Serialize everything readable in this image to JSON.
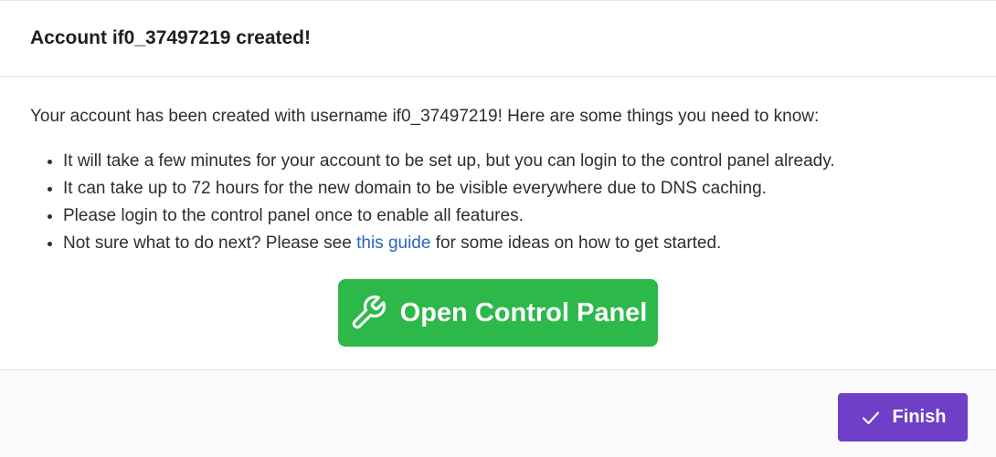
{
  "header": {
    "title": "Account if0_37497219 created!"
  },
  "body": {
    "intro": "Your account has been created with username if0_37497219! Here are some things you need to know:",
    "notes": [
      "It will take a few minutes for your account to be set up, but you can login to the control panel already.",
      "It can take up to 72 hours for the new domain to be visible everywhere due to DNS caching.",
      "Please login to the control panel once to enable all features."
    ],
    "guide_note": {
      "before": "Not sure what to do next? Please see ",
      "link_text": "this guide",
      "after": " for some ideas on how to get started."
    },
    "control_panel_button": {
      "label": "Open Control Panel",
      "icon": "wrench-icon"
    }
  },
  "footer": {
    "finish_button": {
      "label": "Finish",
      "icon": "check-icon"
    }
  },
  "colors": {
    "primary_green": "#2db84a",
    "finish_purple": "#6f3fc7",
    "link_blue": "#2a66b8"
  }
}
